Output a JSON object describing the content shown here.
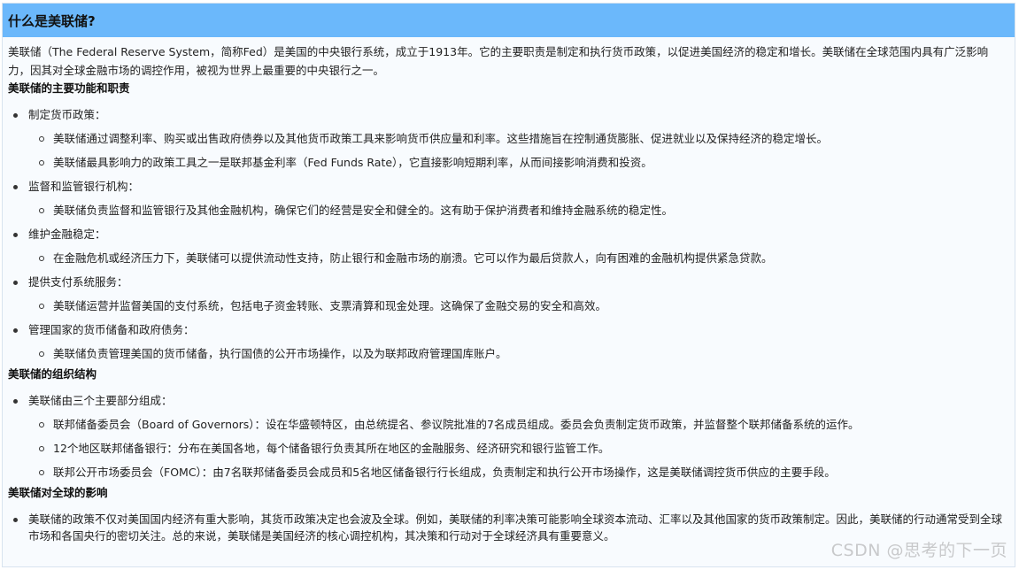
{
  "header": {
    "title": "什么是美联储?"
  },
  "intro": "美联储（The Federal Reserve System，简称Fed）是美国的中央银行系统，成立于1913年。它的主要职责是制定和执行货币政策，以促进美国经济的稳定和增长。美联储在全球范围内具有广泛影响力，因其对全球金融市场的调控作用，被视为世界上最重要的中央银行之一。",
  "sections": [
    {
      "title": "美联储的主要功能和职责",
      "items": [
        {
          "label": "制定货币政策：",
          "subs": [
            "美联储通过调整利率、购买或出售政府债券以及其他货币政策工具来影响货币供应量和利率。这些措施旨在控制通货膨胀、促进就业以及保持经济的稳定增长。",
            "美联储最具影响力的政策工具之一是联邦基金利率（Fed Funds Rate），它直接影响短期利率，从而间接影响消费和投资。"
          ]
        },
        {
          "label": "监督和监管银行机构：",
          "subs": [
            "美联储负责监督和监管银行及其他金融机构，确保它们的经营是安全和健全的。这有助于保护消费者和维持金融系统的稳定性。"
          ]
        },
        {
          "label": "维护金融稳定：",
          "subs": [
            "在金融危机或经济压力下，美联储可以提供流动性支持，防止银行和金融市场的崩溃。它可以作为最后贷款人，向有困难的金融机构提供紧急贷款。"
          ]
        },
        {
          "label": "提供支付系统服务：",
          "subs": [
            "美联储运营并监督美国的支付系统，包括电子资金转账、支票清算和现金处理。这确保了金融交易的安全和高效。"
          ]
        },
        {
          "label": "管理国家的货币储备和政府债务：",
          "subs": [
            "美联储负责管理美国的货币储备，执行国债的公开市场操作，以及为联邦政府管理国库账户。"
          ]
        }
      ]
    },
    {
      "title": "美联储的组织结构",
      "items": [
        {
          "label": "美联储由三个主要部分组成：",
          "subs": [
            "联邦储备委员会（Board of Governors）：设在华盛顿特区，由总统提名、参议院批准的7名成员组成。委员会负责制定货币政策，并监督整个联邦储备系统的运作。",
            "12个地区联邦储备银行：分布在美国各地，每个储备银行负责其所在地区的金融服务、经济研究和银行监管工作。",
            "联邦公开市场委员会（FOMC）：由7名联邦储备委员会成员和5名地区储备银行行长组成，负责制定和执行公开市场操作，这是美联储调控货币供应的主要手段。"
          ]
        }
      ]
    },
    {
      "title": "美联储对全球的影响",
      "items": [
        {
          "label": "美联储的政策不仅对美国国内经济有重大影响，其货币政策决定也会波及全球。例如，美联储的利率决策可能影响全球资本流动、汇率以及其他国家的货币政策制定。因此，美联储的行动通常受到全球市场和各国央行的密切关注。总的来说，美联储是美国经济的核心调控机构，其决策和行动对于全球经济具有重要意义。",
          "subs": []
        }
      ]
    }
  ],
  "watermark": "CSDN @思考的下一页"
}
